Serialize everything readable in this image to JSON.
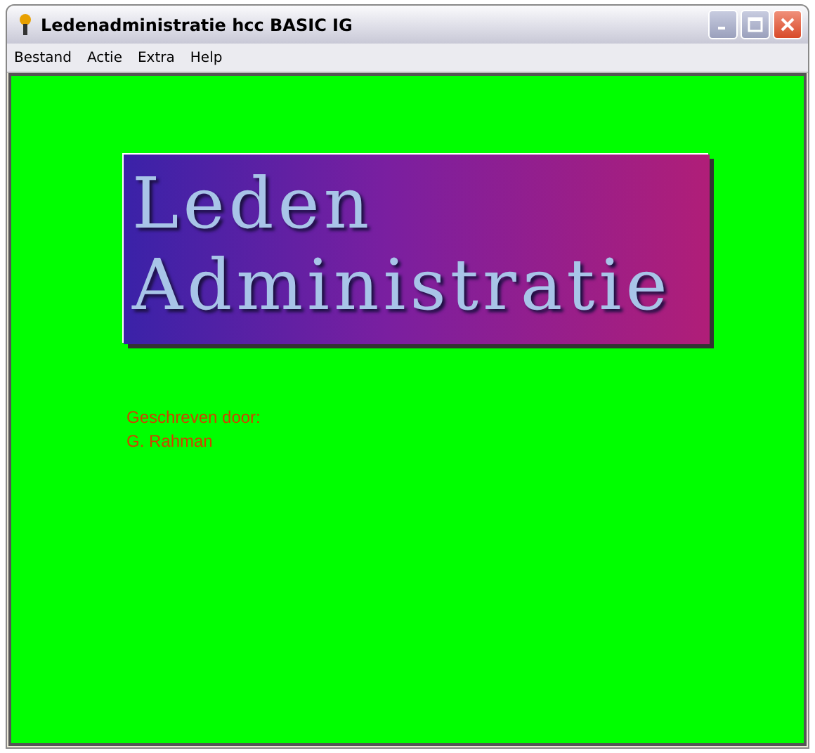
{
  "window": {
    "title": "Ledenadministratie hcc BASIC IG"
  },
  "menu": [
    "Bestand",
    "Actie",
    "Extra",
    "Help"
  ],
  "banner": {
    "lines": [
      "Leden",
      "Administratie"
    ]
  },
  "credits": [
    "Geschreven door:",
    "G. Rahman"
  ]
}
